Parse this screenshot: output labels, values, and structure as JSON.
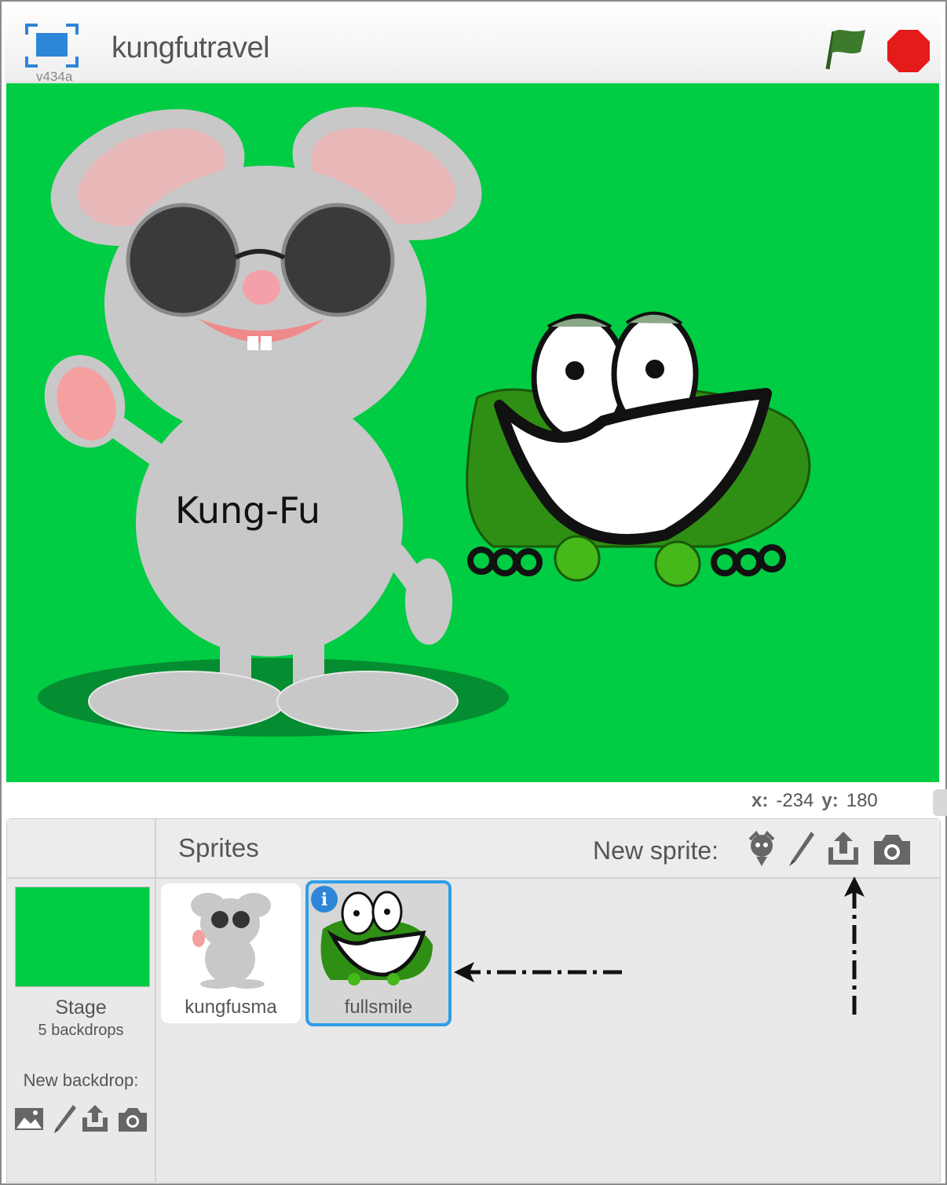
{
  "header": {
    "title": "kungfutravel",
    "version": "v434a",
    "icons": {
      "fullscreen": "fullscreen-icon",
      "flag": "green-flag-icon",
      "stop": "stop-sign-icon"
    },
    "colors": {
      "accent": "#2e9ee8",
      "flag": "#3d7a2c",
      "stop": "#e51a1a"
    }
  },
  "stage": {
    "background": "#00cc44",
    "mouse_shirt_text": "Kung-Fu"
  },
  "coords": {
    "x_label": "x:",
    "x_value": "-234",
    "y_label": "y:",
    "y_value": "180"
  },
  "sprites_pane": {
    "title": "Sprites",
    "new_sprite_label": "New sprite:",
    "new_sprite_icons": [
      "sprite-library-icon",
      "paint-brush-icon",
      "upload-icon",
      "camera-icon"
    ],
    "stage": {
      "label": "Stage",
      "backdrops": "5 backdrops",
      "thumb_color": "#00cc44"
    },
    "new_backdrop_label": "New backdrop:",
    "new_backdrop_icons": [
      "backdrop-library-icon",
      "paint-brush-icon",
      "upload-icon",
      "camera-icon"
    ],
    "sprites": [
      {
        "name": "kungfusma",
        "selected": false
      },
      {
        "name": "fullsmile",
        "selected": true
      }
    ]
  }
}
